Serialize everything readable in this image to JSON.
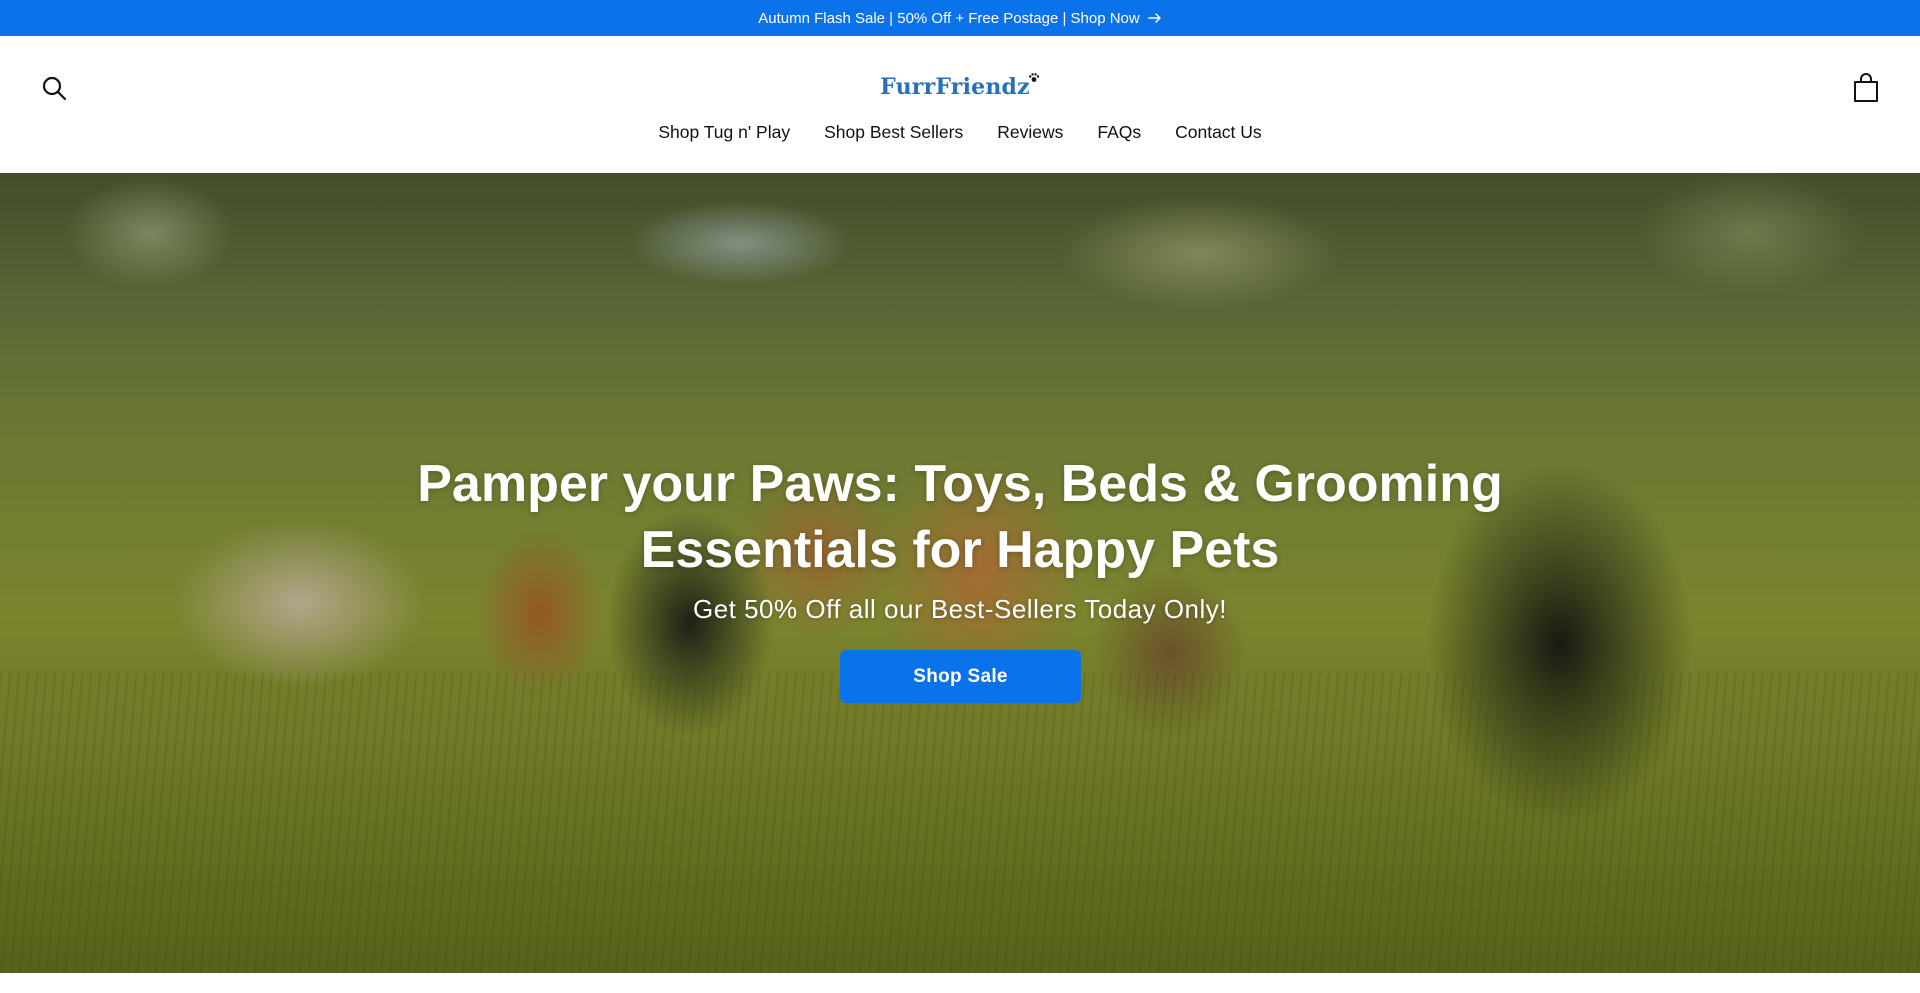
{
  "announcement": {
    "text": "Autumn Flash Sale | 50% Off + Free Postage | Shop Now",
    "background": "#0a73eb"
  },
  "header": {
    "logo": "FurrFriendz",
    "logo_color": "#2a6fb8",
    "search_icon": "search-icon",
    "cart_icon": "shopping-bag-icon"
  },
  "nav": {
    "items": [
      {
        "label": "Shop Tug n' Play"
      },
      {
        "label": "Shop Best Sellers"
      },
      {
        "label": "Reviews"
      },
      {
        "label": "FAQs"
      },
      {
        "label": "Contact Us"
      }
    ]
  },
  "hero": {
    "title_line1": "Pamper your Paws: Toys, Beds & Grooming",
    "title_line2": "Essentials for Happy Pets",
    "subtitle": "Get 50% Off all our Best-Sellers Today Only!",
    "button_label": "Shop Sale",
    "button_color": "#0a73eb"
  }
}
